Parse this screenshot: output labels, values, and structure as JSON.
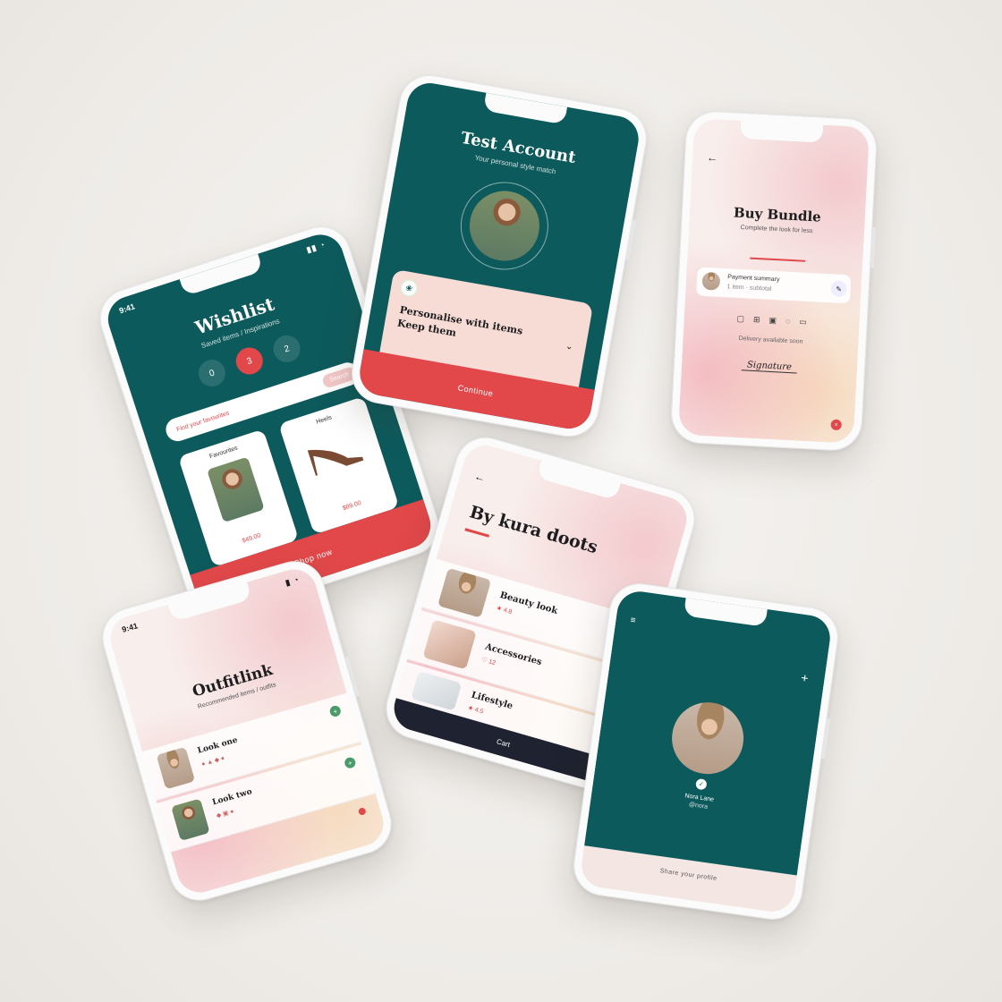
{
  "phones": {
    "wishlist": {
      "time": "9:41",
      "title": "Wishlist",
      "subtitle": "Saved items / Inspirations",
      "circle_buttons": [
        "0",
        "3",
        "2"
      ],
      "search_placeholder": "Find your favourites",
      "search_button": "Search",
      "card1_title": "Favourites",
      "card1_price": "$49.00",
      "card2_title": "Heels",
      "card2_price": "$89.00",
      "cta": "Shop now"
    },
    "test_account": {
      "title": "Test Account",
      "subtitle": "Your personal style match",
      "info_line1": "Personalise with items",
      "info_line2": "Keep them",
      "cta": "Continue"
    },
    "buy_bundle": {
      "title": "Buy Bundle",
      "subtitle": "Complete the look for less",
      "row_label": "Payment summary",
      "row_sub": "1 item · subtotal",
      "note": "Delivery available soon",
      "signature": "Signature"
    },
    "buy_looks": {
      "title": "By kura doots",
      "items": [
        {
          "name": "Beauty look",
          "meta": "★ 4.8"
        },
        {
          "name": "Accessories",
          "meta": "♡ 12"
        },
        {
          "name": "Lifestyle",
          "meta": "★ 4.5"
        }
      ],
      "footer": "Cart"
    },
    "outfit_link": {
      "time": "9:41",
      "title": "Outfitlink",
      "subtitle": "Recommended items / outfits",
      "items": [
        {
          "name": "Look one",
          "tag": "+"
        },
        {
          "name": "Look two",
          "tag": "+"
        }
      ]
    },
    "profile": {
      "name": "Nora Lane",
      "handle": "@nora",
      "footer": "Share your profile"
    }
  },
  "colors": {
    "teal": "#0d5a5c",
    "coral": "#e2484a",
    "blush": "#f8efec"
  }
}
